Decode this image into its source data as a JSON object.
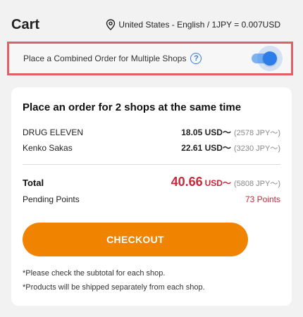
{
  "header": {
    "title": "Cart",
    "locale": "United States - English / 1JPY = 0.007USD"
  },
  "combined_order": {
    "label": "Place a Combined Order for Multiple Shops",
    "help_symbol": "?",
    "enabled": true,
    "accent_color": "#2b7de9",
    "highlight_color": "#e06065"
  },
  "summary": {
    "title": "Place an order for 2 shops at the same time",
    "shops": [
      {
        "name": "DRUG ELEVEN",
        "usd": "18.05",
        "usd_unit": "USD～",
        "jpy": "(2578 JPY～)"
      },
      {
        "name": "Kenko Sakas",
        "usd": "22.61",
        "usd_unit": "USD～",
        "jpy": "(3230 JPY～)"
      }
    ],
    "total": {
      "label": "Total",
      "amount": "40.66",
      "unit": "USD～",
      "jpy": "(5808 JPY～)"
    },
    "points": {
      "label": "Pending Points",
      "value": "73 Points"
    },
    "checkout_label": "CHECKOUT",
    "checkout_color": "#f08300",
    "notes": [
      "*Please check the subtotal for each shop.",
      "*Products will be shipped separately from each shop."
    ]
  }
}
